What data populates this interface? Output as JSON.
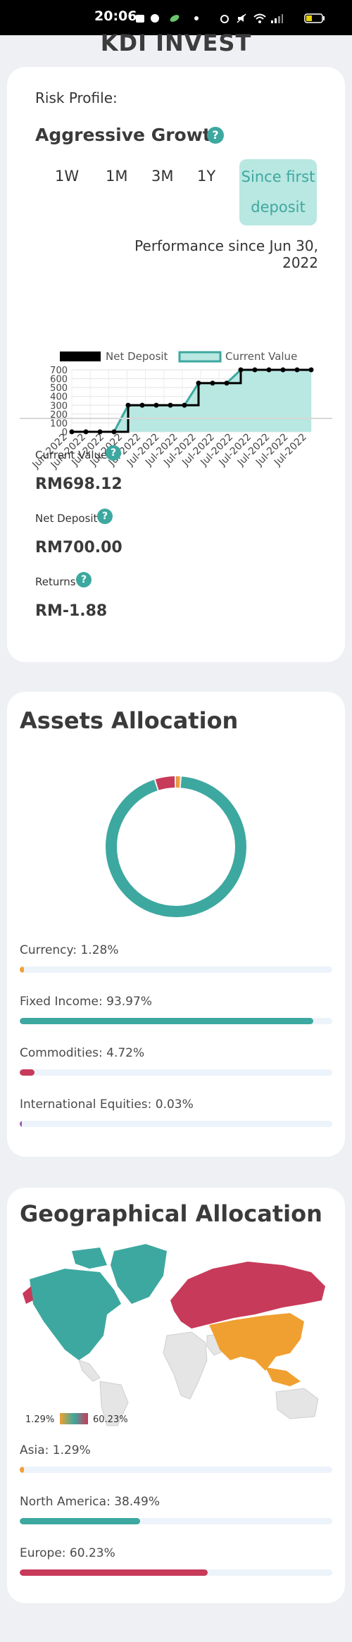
{
  "status_bar": {
    "time": "20:06"
  },
  "header": {
    "title": "KDI INVEST"
  },
  "portfolio": {
    "risk_label": "Risk Profile:",
    "risk_value": "Aggressive Growth",
    "help_glyph": "?",
    "periods": [
      {
        "label": "1W"
      },
      {
        "label": "1M"
      },
      {
        "label": "3M"
      },
      {
        "label": "1Y"
      }
    ],
    "active_period_line1": "Since first",
    "active_period_line2": "deposit",
    "performance_text": "Performance since Jun 30, 2022",
    "current_value_label": "Current Value",
    "current_value": "RM698.12",
    "net_deposit_label": "Net Deposit",
    "net_deposit": "RM700.00",
    "returns_label": "Returns",
    "returns": "RM-1.88"
  },
  "chart_data": {
    "type": "line",
    "categories": [
      "Jun-2022",
      "Jun-2022",
      "Jul-2022",
      "Jul-2022",
      "Jul-2022",
      "Jul-2022",
      "Jul-2022",
      "Jul-2022",
      "Jul-2022",
      "Jul-2022",
      "Jul-2022",
      "Jul-2022",
      "Jul-2022",
      "Jul-2022"
    ],
    "series": [
      {
        "name": "Net Deposit",
        "values": [
          0,
          0,
          0,
          0,
          300,
          300,
          300,
          300,
          300,
          550,
          550,
          550,
          700,
          700,
          700,
          700,
          700,
          700
        ],
        "color": "#000000"
      },
      {
        "name": "Current Value",
        "values": [
          0,
          0,
          0,
          0,
          300,
          300,
          300,
          300,
          300,
          550,
          550,
          550,
          700,
          700,
          700,
          700,
          700,
          698.12
        ],
        "color": "#3da8a0"
      }
    ],
    "x_points": 18,
    "yticks": [
      "0",
      "100",
      "200",
      "300",
      "400",
      "500",
      "600",
      "700"
    ],
    "ylim": [
      0,
      700
    ],
    "legend": "top"
  },
  "assets": {
    "title": "Assets Allocation",
    "items": [
      {
        "label": "Currency: 1.28%",
        "value": 1.28,
        "color": "#f0a030"
      },
      {
        "label": "Fixed Income: 93.97%",
        "value": 93.97,
        "color": "#3da8a0"
      },
      {
        "label": "Commodities: 4.72%",
        "value": 4.72,
        "color": "#c83a5a"
      },
      {
        "label": "International Equities: 0.03%",
        "value": 0.03,
        "color": "#9b59b6"
      }
    ]
  },
  "geo": {
    "title": "Geographical Allocation",
    "legend_min": "1.29%",
    "legend_max": "60.23%",
    "items": [
      {
        "label": "Asia: 1.29%",
        "value": 1.29,
        "color": "#f0a030"
      },
      {
        "label": "North America: 38.49%",
        "value": 38.49,
        "color": "#3da8a0"
      },
      {
        "label": "Europe: 60.23%",
        "value": 60.23,
        "color": "#c83a5a"
      }
    ]
  }
}
